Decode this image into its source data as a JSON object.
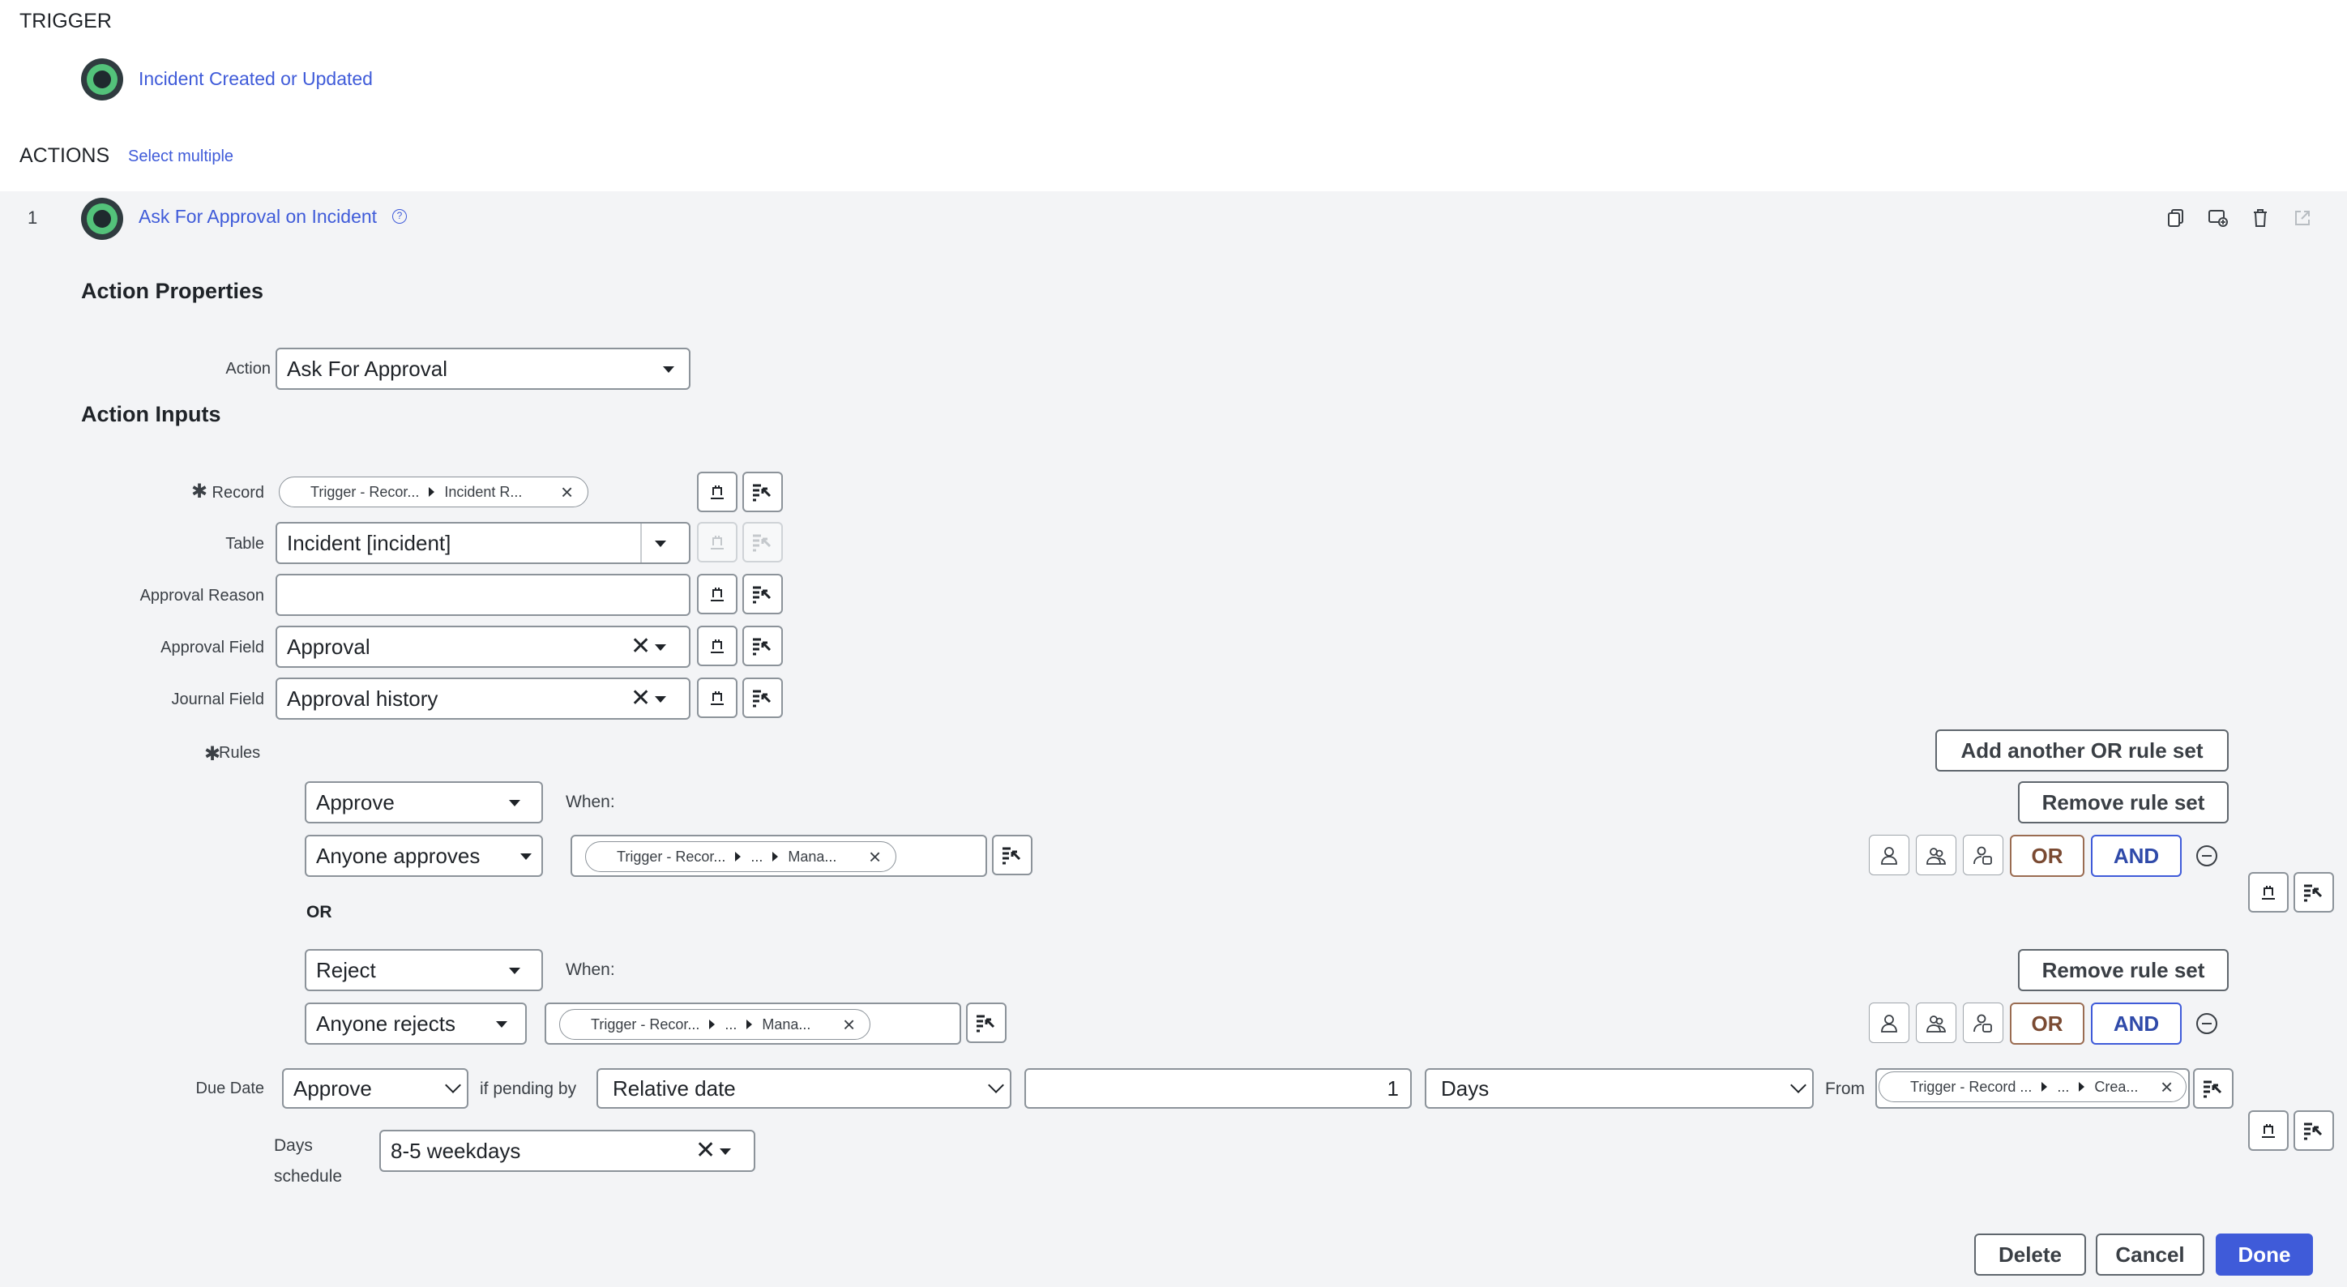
{
  "trigger": {
    "section_title": "TRIGGER",
    "name": "Incident Created or Updated"
  },
  "actions": {
    "section_title": "ACTIONS",
    "select_multiple": "Select multiple",
    "item_number": "1",
    "item_name": "Ask For Approval on Incident"
  },
  "action_properties": {
    "title": "Action Properties",
    "action_label": "Action",
    "action_value": "Ask For Approval"
  },
  "action_inputs": {
    "title": "Action Inputs",
    "record_label": "Record",
    "record_pill_part1": "Trigger - Recor...",
    "record_pill_part2": "Incident R...",
    "table_label": "Table",
    "table_value": "Incident [incident]",
    "approval_reason_label": "Approval Reason",
    "approval_reason_value": "",
    "approval_field_label": "Approval Field",
    "approval_field_value": "Approval",
    "journal_field_label": "Journal Field",
    "journal_field_value": "Approval history",
    "rules_label": "Rules"
  },
  "rules": {
    "add_or_rule_set": "Add another OR rule set",
    "remove_rule_set": "Remove rule set",
    "or_separator": "OR",
    "or_button": "OR",
    "and_button": "AND",
    "when_label": "When:",
    "set1": {
      "action": "Approve",
      "condition": "Anyone approves",
      "pill_part1": "Trigger - Recor...",
      "pill_part2": "...",
      "pill_part3": "Mana..."
    },
    "set2": {
      "action": "Reject",
      "condition": "Anyone rejects",
      "pill_part1": "Trigger - Recor...",
      "pill_part2": "...",
      "pill_part3": "Mana..."
    }
  },
  "due_date": {
    "label": "Due Date",
    "action": "Approve",
    "if_pending_by": "if pending by",
    "date_type": "Relative date",
    "amount": "1",
    "unit": "Days",
    "from_label": "From",
    "pill_part1": "Trigger - Record ...",
    "pill_part2": "...",
    "pill_part3": "Crea...",
    "days_schedule_label_line1": "Days",
    "days_schedule_label_line2": "schedule",
    "days_schedule_value": "8-5 weekdays"
  },
  "footer": {
    "delete": "Delete",
    "cancel": "Cancel",
    "done": "Done"
  },
  "colors": {
    "accent": "#3f5bd9",
    "or_brown": "#7a4a32",
    "panel_bg": "#f3f4f6"
  }
}
